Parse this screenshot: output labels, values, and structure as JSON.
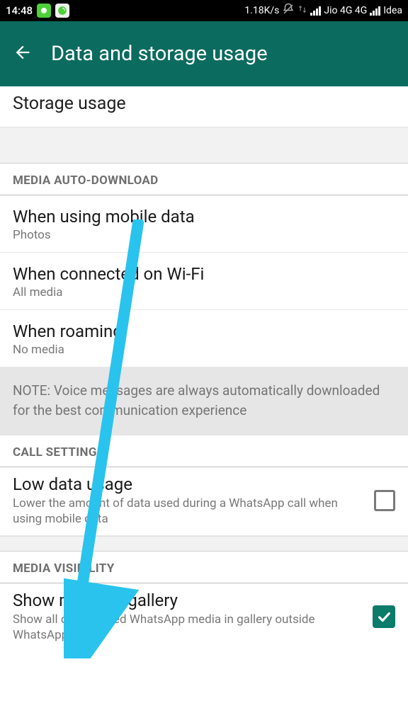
{
  "status": {
    "time": "14:48",
    "speed": "1.18K/s",
    "carrier1": "Jio 4G 4G",
    "carrier2": "Idea"
  },
  "header": {
    "title": "Data and storage usage"
  },
  "storage": {
    "title": "Storage usage"
  },
  "media_autodl": {
    "header": "MEDIA AUTO-DOWNLOAD",
    "mobile": {
      "title": "When using mobile data",
      "sub": "Photos"
    },
    "wifi": {
      "title": "When connected on Wi-Fi",
      "sub": "All media"
    },
    "roaming": {
      "title": "When roaming",
      "sub": "No media"
    },
    "note": "NOTE: Voice messages are always automatically downloaded for the best communication experience"
  },
  "call": {
    "header": "CALL SETTINGS",
    "lowdata": {
      "title": "Low data usage",
      "sub": "Lower the amount of data used during a WhatsApp call when using mobile data"
    }
  },
  "media_vis": {
    "header": "MEDIA VISIBILITY",
    "show": {
      "title": "Show media in gallery",
      "sub": "Show all downloaded WhatsApp media in gallery outside WhatsApp"
    }
  }
}
